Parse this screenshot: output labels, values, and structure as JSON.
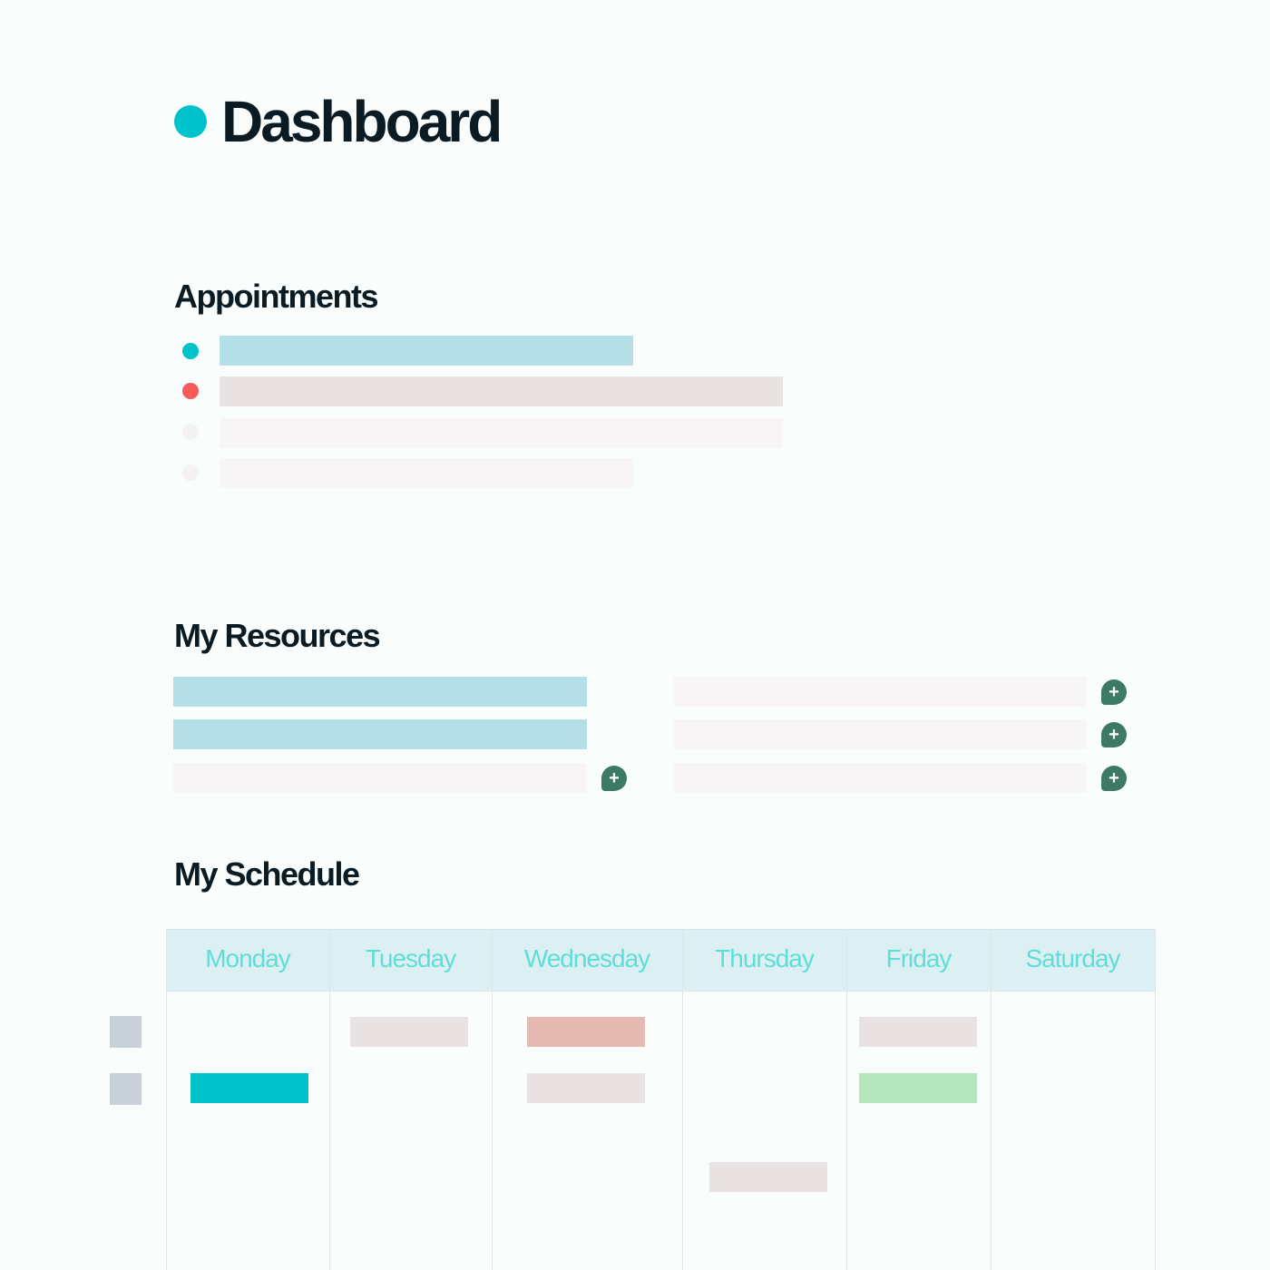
{
  "page": {
    "title": "Dashboard",
    "accent_color": "#00c2cb"
  },
  "appointments": {
    "heading": "Appointments",
    "items": [
      {
        "dot_color": "#00c2cb",
        "bar_color": "#b4dfe6"
      },
      {
        "dot_color": "#f45b5b",
        "bar_color": "#e8e2e2"
      },
      {
        "dot_color": "#f5f2f2",
        "bar_color": "#f7f5f5"
      },
      {
        "dot_color": "#f5f2f2",
        "bar_color": "#f7f5f5"
      }
    ]
  },
  "resources": {
    "heading": "My Resources",
    "add_icon": "plus-icon",
    "add_label": "+",
    "left_column": [
      {
        "bar_color": "#b4dfe6",
        "has_add": false
      },
      {
        "bar_color": "#b4dfe6",
        "has_add": false
      },
      {
        "bar_color": "#f7f5f5",
        "has_add": true
      }
    ],
    "right_column": [
      {
        "bar_color": "#f7f5f5",
        "has_add": true
      },
      {
        "bar_color": "#f7f5f5",
        "has_add": true
      },
      {
        "bar_color": "#f7f5f5",
        "has_add": true
      }
    ]
  },
  "schedule": {
    "heading": "My Schedule",
    "days": [
      "Monday",
      "Tuesday",
      "Wednesday",
      "Thursday",
      "Friday",
      "Saturday"
    ],
    "header_color": "#dcf0f4",
    "day_label_color": "#5fded8",
    "row_marker_color": "#c8d0da",
    "events": [
      {
        "day": "Tuesday",
        "row": 1,
        "color": "#e8e2e2"
      },
      {
        "day": "Wednesday",
        "row": 1,
        "color": "#e5bab3"
      },
      {
        "day": "Friday",
        "row": 1,
        "color": "#e8e2e2"
      },
      {
        "day": "Monday",
        "row": 2,
        "color": "#00c2cb"
      },
      {
        "day": "Wednesday",
        "row": 2,
        "color": "#e8e2e2"
      },
      {
        "day": "Friday",
        "row": 2,
        "color": "#b5e6bd"
      },
      {
        "day": "Thursday",
        "row": 3,
        "color": "#e8e2e2"
      }
    ]
  }
}
